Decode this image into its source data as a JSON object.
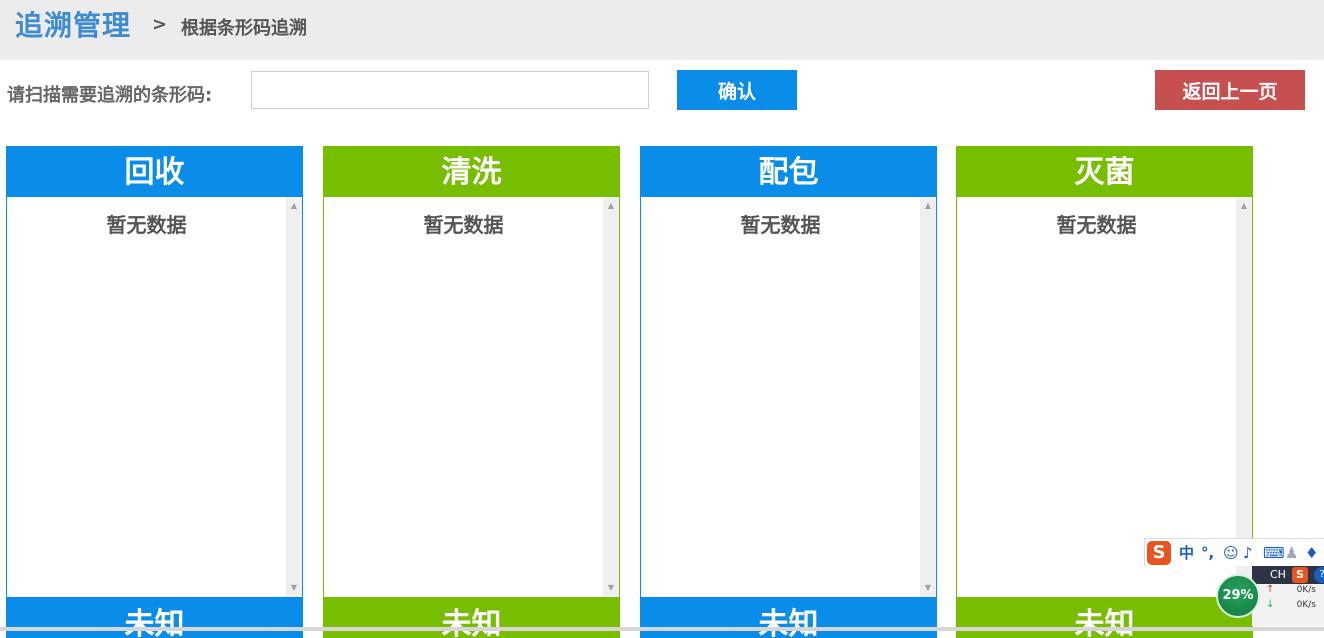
{
  "header": {
    "title": "追溯管理",
    "separator": ">",
    "breadcrumb_current": "根据条形码追溯"
  },
  "scan": {
    "label": "请扫描需要追溯的条形码:",
    "input_value": "",
    "confirm_label": "确认",
    "back_label": "返回上一页"
  },
  "panels": [
    {
      "title": "回收",
      "empty": "暂无数据",
      "color": "#0a8de8"
    },
    {
      "title": "清洗",
      "empty": "暂无数据",
      "color": "#77bd00"
    },
    {
      "title": "配包",
      "empty": "暂无数据",
      "color": "#0a8de8"
    },
    {
      "title": "灭菌",
      "empty": "暂无数据",
      "color": "#77bd00"
    }
  ],
  "panels_row2": [
    {
      "title": "未知",
      "color": "#0a8de8"
    },
    {
      "title": "未知",
      "color": "#77bd00"
    },
    {
      "title": "未知",
      "color": "#0a8de8"
    },
    {
      "title": "未知",
      "color": "#77bd00"
    }
  ],
  "ime": {
    "logo": "S",
    "mode": "中",
    "punct": "°,",
    "icons": [
      "smile-icon",
      "mic-icon",
      "keyboard-icon",
      "user-icon",
      "shirt-icon"
    ]
  },
  "tray": {
    "lang": "CH",
    "ime_logo": "S",
    "help": "?",
    "cpu": "29%",
    "upload": "0K/s",
    "download": "0K/s"
  }
}
